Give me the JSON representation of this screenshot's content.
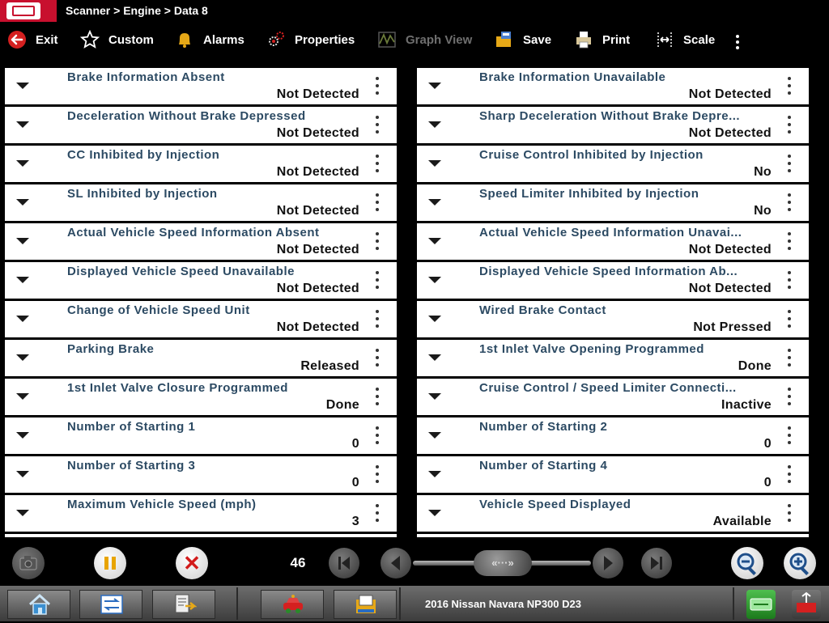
{
  "breadcrumb": "Scanner > Engine > Data 8",
  "toolbar": {
    "exit": "Exit",
    "custom": "Custom",
    "alarms": "Alarms",
    "properties": "Properties",
    "graph_view": "Graph View",
    "save": "Save",
    "print": "Print",
    "scale": "Scale"
  },
  "left_rows": [
    {
      "label": "Brake Information Absent",
      "value": "Not Detected"
    },
    {
      "label": "Deceleration Without Brake Depressed",
      "value": "Not Detected"
    },
    {
      "label": "CC Inhibited by Injection",
      "value": "Not Detected"
    },
    {
      "label": "SL Inhibited by Injection",
      "value": "Not Detected"
    },
    {
      "label": "Actual Vehicle Speed Information Absent",
      "value": "Not Detected"
    },
    {
      "label": "Displayed Vehicle Speed Unavailable",
      "value": "Not Detected"
    },
    {
      "label": "Change of Vehicle Speed Unit",
      "value": "Not Detected"
    },
    {
      "label": "Parking Brake",
      "value": "Released"
    },
    {
      "label": "1st Inlet Valve Closure Programmed",
      "value": "Done"
    },
    {
      "label": "Number of Starting 1",
      "value": "0"
    },
    {
      "label": "Number of Starting 3",
      "value": "0"
    },
    {
      "label": "Maximum Vehicle Speed (mph)",
      "value": "3"
    }
  ],
  "right_rows": [
    {
      "label": "Brake Information Unavailable",
      "value": "Not Detected"
    },
    {
      "label": "Sharp Deceleration Without Brake Depre...",
      "value": "Not Detected"
    },
    {
      "label": "Cruise Control Inhibited by Injection",
      "value": "No"
    },
    {
      "label": "Speed Limiter Inhibited by Injection",
      "value": "No"
    },
    {
      "label": "Actual Vehicle Speed Information Unavai...",
      "value": "Not Detected"
    },
    {
      "label": "Displayed Vehicle Speed Information Ab...",
      "value": "Not Detected"
    },
    {
      "label": "Wired Brake Contact",
      "value": "Not Pressed"
    },
    {
      "label": "1st Inlet Valve Opening Programmed",
      "value": "Done"
    },
    {
      "label": "Cruise Control / Speed Limiter Connecti...",
      "value": "Inactive"
    },
    {
      "label": "Number of Starting 2",
      "value": "0"
    },
    {
      "label": "Number of Starting 4",
      "value": "0"
    },
    {
      "label": "Vehicle Speed Displayed",
      "value": "Available"
    }
  ],
  "controls": {
    "page_number": "46",
    "slider_thumb_label": "«···»"
  },
  "vehicle": "2016 Nissan Navara NP300 D23",
  "colors": {
    "brand_red": "#c8102e",
    "label_blue": "#2c4a63",
    "stop_red": "#d21b1b",
    "pause_amber": "#e8a400"
  }
}
